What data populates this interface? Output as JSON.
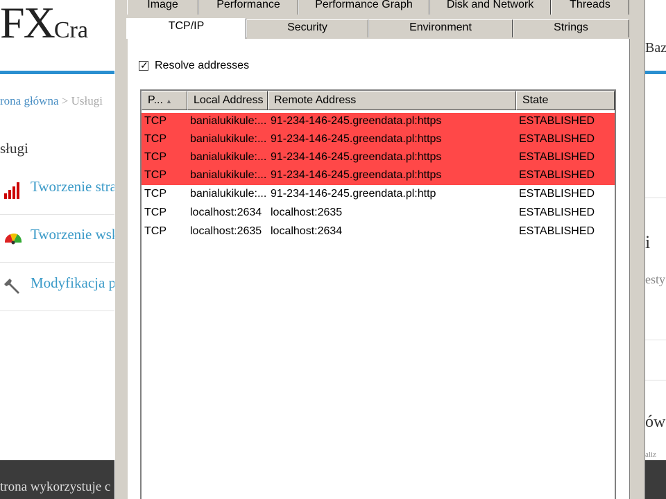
{
  "background": {
    "logo_big": "FX",
    "logo_small": "Cra",
    "breadcrumb_home": "rona główna",
    "breadcrumb_sep": ">",
    "breadcrumb_current": "Usługi",
    "section_title": "sługi",
    "services": [
      {
        "label": "Tworzenie stra",
        "icon": "signal-bars-icon"
      },
      {
        "label": "Tworzenie wsk",
        "icon": "gauge-icon"
      },
      {
        "label": "Modyfikacja p",
        "icon": "wrench-icon"
      }
    ],
    "cookie_text": "trona wykorzystuje c",
    "right_fragments": [
      "Baz",
      "i",
      "esty",
      "ów",
      "aliz"
    ]
  },
  "dialog": {
    "tabs_row1": [
      "Image",
      "Performance",
      "Performance Graph",
      "Disk and Network",
      "Threads"
    ],
    "tabs_row2": [
      "TCP/IP",
      "Security",
      "Environment",
      "Strings"
    ],
    "active_tab": "TCP/IP",
    "resolve_checkbox": {
      "label": "Resolve addresses",
      "checked": true,
      "mark": "✓"
    },
    "columns": [
      "P...",
      "Local Address",
      "Remote Address",
      "State"
    ],
    "sort_indicator": "▲",
    "highlight_color": "#ff4848",
    "rows": [
      {
        "proto": "TCP",
        "local": "banialukikule:...",
        "remote": "91-234-146-245.greendata.pl:https",
        "state": "ESTABLISHED",
        "highlighted": true
      },
      {
        "proto": "TCP",
        "local": "banialukikule:...",
        "remote": "91-234-146-245.greendata.pl:https",
        "state": "ESTABLISHED",
        "highlighted": true
      },
      {
        "proto": "TCP",
        "local": "banialukikule:...",
        "remote": "91-234-146-245.greendata.pl:https",
        "state": "ESTABLISHED",
        "highlighted": true
      },
      {
        "proto": "TCP",
        "local": "banialukikule:...",
        "remote": "91-234-146-245.greendata.pl:https",
        "state": "ESTABLISHED",
        "highlighted": true
      },
      {
        "proto": "TCP",
        "local": "banialukikule:...",
        "remote": "91-234-146-245.greendata.pl:http",
        "state": "ESTABLISHED",
        "highlighted": false
      },
      {
        "proto": "TCP",
        "local": "localhost:2634",
        "remote": "localhost:2635",
        "state": "ESTABLISHED",
        "highlighted": false
      },
      {
        "proto": "TCP",
        "local": "localhost:2635",
        "remote": "localhost:2634",
        "state": "ESTABLISHED",
        "highlighted": false
      }
    ]
  }
}
